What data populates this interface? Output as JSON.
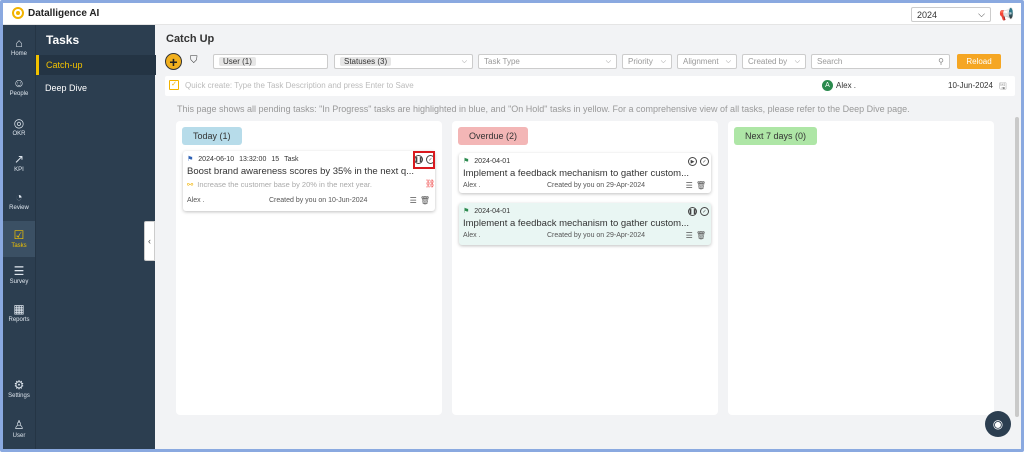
{
  "app": {
    "logo_text": "Datalligence AI"
  },
  "topbar": {
    "year": "2024"
  },
  "rail": [
    {
      "label": "Home",
      "icon": "home-icon",
      "glyph": "⌂"
    },
    {
      "label": "People",
      "icon": "people-icon",
      "glyph": "☺"
    },
    {
      "label": "OKR",
      "icon": "target-icon",
      "glyph": "◎"
    },
    {
      "label": "KPI",
      "icon": "chart-icon",
      "glyph": "↗"
    },
    {
      "label": "Review",
      "icon": "gauge-icon",
      "glyph": "◔"
    },
    {
      "label": "Tasks",
      "icon": "tasks-icon",
      "glyph": "☑"
    },
    {
      "label": "Survey",
      "icon": "survey-icon",
      "glyph": "☰"
    },
    {
      "label": "Reports",
      "icon": "reports-icon",
      "glyph": "▦"
    },
    {
      "label": "Settings",
      "icon": "gear-icon",
      "glyph": "⚙"
    },
    {
      "label": "User",
      "icon": "user-icon",
      "glyph": "♙"
    }
  ],
  "subnav": {
    "title": "Tasks",
    "items": [
      {
        "label": "Catch-up"
      },
      {
        "label": "Deep Dive"
      }
    ]
  },
  "page": {
    "title": "Catch Up"
  },
  "filters": {
    "user_chip": "User (1)",
    "status_chip": "Statuses (3)",
    "task_type": "Task Type",
    "priority": "Priority",
    "alignment": "Alignment",
    "created_by": "Created by",
    "search_placeholder": "Search",
    "reload": "Reload"
  },
  "quick_create": {
    "placeholder": "Quick create: Type the Task Description and press Enter to Save",
    "user_initial": "A",
    "user_name": "Alex .",
    "date": "10-Jun-2024"
  },
  "info_text": "This page shows all pending tasks: \"In Progress\" tasks are highlighted in blue, and \"On Hold\" tasks in yellow. For a comprehensive view of all tasks, please refer to the Deep Dive page.",
  "columns": [
    {
      "header": "Today (1)",
      "color": "#b7dcea",
      "cards": [
        {
          "date": "2024-06-10",
          "time": "13:32:00",
          "num": "15",
          "kind": "Task",
          "title": "Boost brand awareness scores by 35% in the next q...",
          "sub": "Increase the customer base by 20% in the next year.",
          "owner": "Alex .",
          "created": "Created by you on 10-Jun-2024"
        }
      ]
    },
    {
      "header": "Overdue (2)",
      "color": "#f3b6b6",
      "cards": [
        {
          "date": "2024-04-01",
          "title": "Implement a feedback mechanism to gather custom...",
          "owner": "Alex .",
          "created": "Created by you on 29-Apr-2024"
        },
        {
          "date": "2024-04-01",
          "title": "Implement a feedback mechanism to gather custom...",
          "owner": "Alex .",
          "created": "Created by you on 29-Apr-2024"
        }
      ]
    },
    {
      "header": "Next 7 days (0)",
      "color": "#aee6a6",
      "cards": []
    }
  ],
  "colors": {
    "accent": "#f5a623",
    "nav_bg": "#2c3e50",
    "nav_active": "#f2c200",
    "highlight": "#d9191e",
    "on_hold_bg": "#e9f6f3"
  }
}
